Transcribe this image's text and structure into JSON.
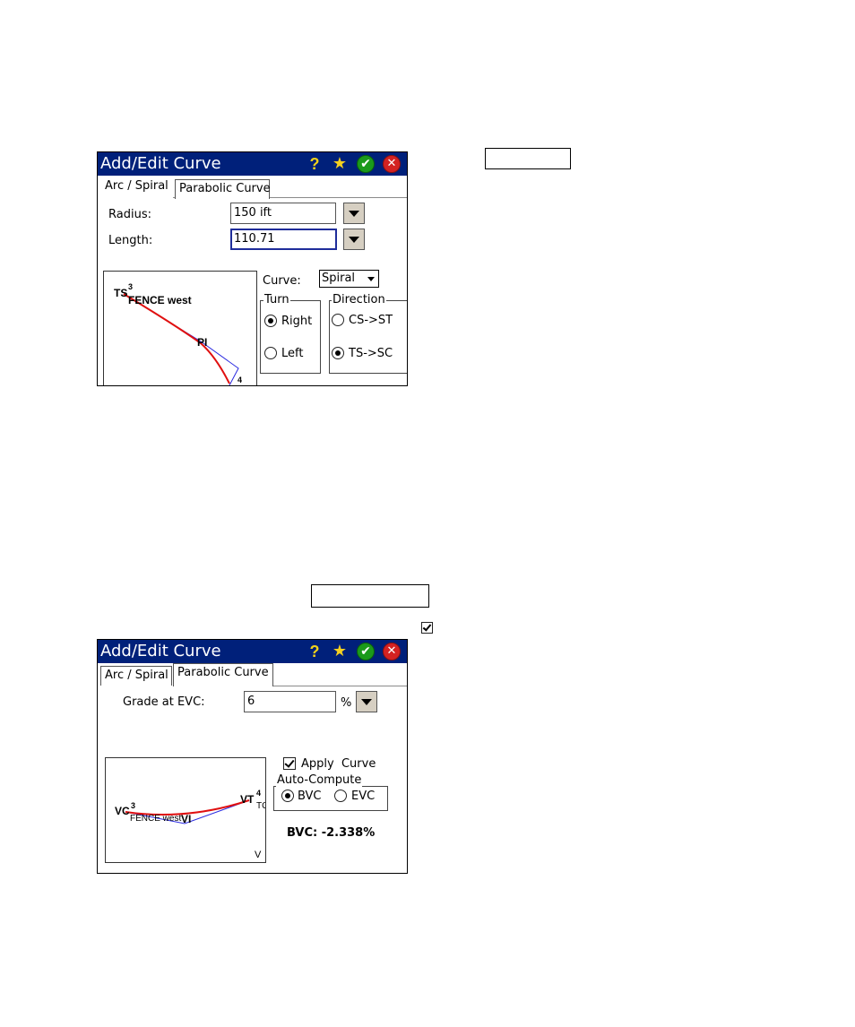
{
  "top_window": {
    "title": "Add/Edit Curve",
    "tabs": [
      {
        "label": "Arc / Spiral",
        "active": true
      },
      {
        "label": "Parabolic Curve",
        "active": false
      }
    ],
    "radius": {
      "label": "Radius:",
      "value": "150 ift"
    },
    "length": {
      "label": "Length:",
      "value": "110.71"
    },
    "curve": {
      "label": "Curve:",
      "selected": "Spiral"
    },
    "turn": {
      "legend": "Turn",
      "options": [
        "Right",
        "Left"
      ],
      "selected": "Right"
    },
    "direction": {
      "legend": "Direction",
      "options": [
        "CS->ST",
        "TS->SC"
      ],
      "selected": "TS->SC"
    },
    "preview": {
      "labels": {
        "ts": "TS",
        "ts_sup": "3",
        "fence": "FENCE west",
        "pi": "PI",
        "end_sup": "4"
      }
    }
  },
  "bottom_window": {
    "title": "Add/Edit Curve",
    "tabs": [
      {
        "label": "Arc / Spiral",
        "active": false
      },
      {
        "label": "Parabolic Curve",
        "active": true
      }
    ],
    "grade": {
      "label": "Grade at EVC:",
      "value": "6",
      "unit": "%"
    },
    "apply_curve": {
      "label": "Apply  Curve",
      "checked": true
    },
    "auto_compute": {
      "legend": "Auto-Compute",
      "options": [
        "BVC",
        "EVC"
      ],
      "selected": "BVC"
    },
    "result": "BVC: -2.338%",
    "preview": {
      "labels": {
        "vc": "VC",
        "vc_sup": "3",
        "vt": "VT",
        "vt_sup": "4",
        "tc": "TC",
        "fence": "FENCE west",
        "vi": "VI",
        "v": "V"
      }
    }
  },
  "colors": {
    "titlebar": "#00207a",
    "curve": "#e01010",
    "tangent": "#2a2ae0",
    "focus_border": "#1f2d9a"
  },
  "icons": [
    "help-icon",
    "favorite-icon",
    "ok-icon",
    "close-icon",
    "dropdown-arrow-icon",
    "checkbox-icon"
  ]
}
